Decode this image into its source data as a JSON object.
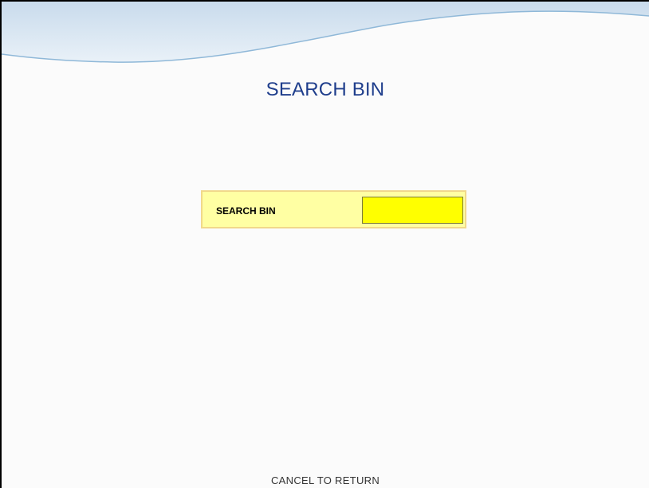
{
  "page_title": "SEARCH BIN",
  "search_field": {
    "label": "SEARCH BIN",
    "value": ""
  },
  "footer": {
    "cancel_text": "CANCEL TO RETURN"
  },
  "colors": {
    "title": "#1f3e8c",
    "field_panel": "#ffffa3",
    "input_bg": "#ffff00",
    "header_wave": "#cfe0ef"
  }
}
